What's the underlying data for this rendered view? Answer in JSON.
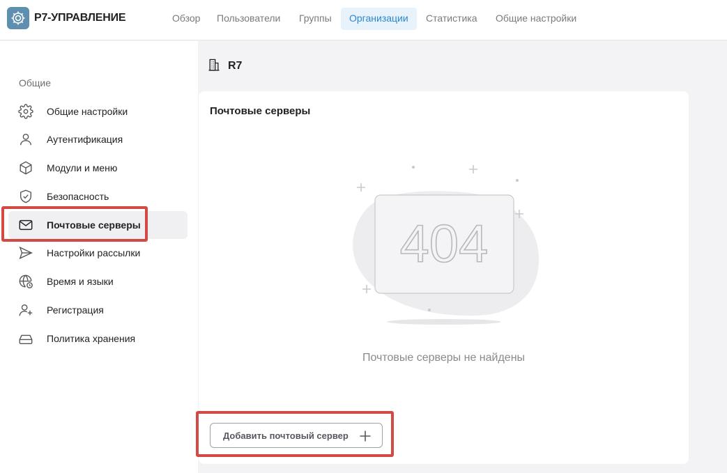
{
  "app": {
    "brand": "Р7-УПРАВЛЕНИЕ"
  },
  "nav": {
    "items": [
      {
        "label": "Обзор",
        "active": false
      },
      {
        "label": "Пользователи",
        "active": false
      },
      {
        "label": "Группы",
        "active": false
      },
      {
        "label": "Организации",
        "active": true
      },
      {
        "label": "Статистика",
        "active": false
      },
      {
        "label": "Общие настройки",
        "active": false
      }
    ]
  },
  "sidebar": {
    "section": "Общие",
    "items": [
      {
        "label": "Общие настройки",
        "icon": "gear-icon"
      },
      {
        "label": "Аутентификация",
        "icon": "user-icon"
      },
      {
        "label": "Модули и меню",
        "icon": "cube-icon"
      },
      {
        "label": "Безопасность",
        "icon": "shield-check-icon"
      },
      {
        "label": "Почтовые серверы",
        "icon": "mail-icon",
        "active": true
      },
      {
        "label": "Настройки рассылки",
        "icon": "send-icon"
      },
      {
        "label": "Время и языки",
        "icon": "globe-clock-icon"
      },
      {
        "label": "Регистрация",
        "icon": "user-plus-icon"
      },
      {
        "label": "Политика хранения",
        "icon": "storage-icon"
      }
    ]
  },
  "content": {
    "org_name": "R7",
    "card_title": "Почтовые серверы",
    "illustration_text": "404",
    "empty_text": "Почтовые серверы не найдены",
    "add_button": "Добавить почтовый сервер"
  },
  "colors": {
    "accent": "#2c86d1",
    "highlight": "#d24a43",
    "logo": "#5f8fae"
  }
}
